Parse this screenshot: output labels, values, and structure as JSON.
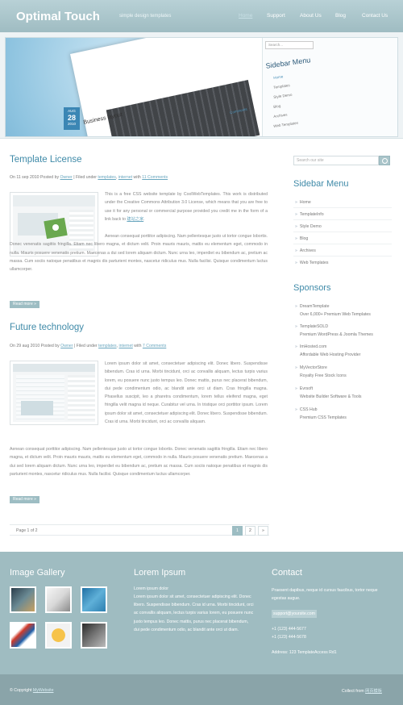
{
  "header": {
    "logo": "Optimal Touch",
    "tagline": "simple design templates",
    "nav": [
      "Home",
      "Support",
      "About Us",
      "Blog",
      "Contact Us"
    ]
  },
  "banner": {
    "search_placeholder": "Search...",
    "menu_title": "Sidebar Menu",
    "menu_items": [
      "Home",
      "Templates",
      "Style Demo",
      "Blog",
      "Archives",
      "Web Templates"
    ],
    "post_title": "Business layout",
    "date_month": "AUG",
    "date_day": "28",
    "date_year": "2010",
    "comments_link": "Comments"
  },
  "posts": [
    {
      "title": "Template License",
      "meta_prefix": "On 11 sep 2010 Posted by ",
      "author": "Owner",
      "meta_mid": " | Filed under ",
      "cat1": "templates",
      "sep": ", ",
      "cat2": "internet",
      "with": " with ",
      "comments": "11 Comments",
      "p1": "This is a free CSS website template by CoolWebTemplates. This work is distributed under the Creative Commons Attribution 3.0 License, which means that you are free to use it for any personal or commercial purpose provided you credit me in the form of a link back to",
      "p1_link": "建站之家",
      "p1_end": ".",
      "p2": "Aenean consequat porttitor adipiscing. Nam pellentesque justo ut tortor congue lobortis. Donec venenatis sagittis fringilla. Etiam nec libero magna, et dictum velit. Proin mauris mauris, mattis eu elementum eget, commodo in nulla. Mauris posuere venenatis pretium. Maecenas a dui sed lorem aliquam dictum. Nunc urna leo, imperdiet eu bibendum ac, pretium ac massa. Cum sociis natoque penatibus et magnis dis parturient montes, nascetur ridiculus mus. Nulla facilisi. Quisque condimentum luctus ullamcorper.",
      "more": "Read more »"
    },
    {
      "title": "Future technology",
      "meta_prefix": "On 29 aug 2010 Posted by ",
      "author": "Owner",
      "meta_mid": " | Filed under ",
      "cat1": "templates",
      "sep": ", ",
      "cat2": "internet",
      "with": " with ",
      "comments": "7 Comments",
      "p1": "Lorem ipsum dolor sit amet, consectetuer adipiscing elit. Donec libero. Suspendisse bibendum. Cras id urna. Morbi tincidunt, orci ac convallis aliquam, lectus turpis varius lorem, eu posuere nunc justo tempus leo. Donec mattis, purus nec placerat bibendum, dui pede condimentum odio, ac blandit ante orci ut diam. Cras fringilla magna. Phasellus suscipit, leo a pharetra condimentum, lorem tellus eleifend magna, eget fringilla velit magna id neque. Curabitur vel urna. In tristique orci porttitor ipsum. Lorem ipsum dolor sit amet, consectetuer adipiscing elit. Donec libero. Suspendisse bibendum. Cras id urna. Morbi tincidunt, orci ac convallis aliquam.",
      "p2": "Aenean consequat porttitor adipiscing. Nam pellentesque justo ut tortor congue lobortis. Donec venenatis sagittis fringilla. Etiam nec libero magna, et dictum velit. Proin mauris mauris, mattis eu elementum eget, commodo in nulla. Mauris posuere venenatis pretium. Maecenas a dui sed lorem aliquam dictum. Nunc urna leo, imperdiet eu bibendum ac, pretium ac massa. Cum sociis natoque penatibus et magnis dis parturient montes, nascetur ridiculus mus. Nulla facilisi. Quisque condimentum luctus ullamcorper.",
      "more": "Read more »"
    }
  ],
  "pager": {
    "label": "Page 1 of 2",
    "pages": [
      "1",
      "2",
      "»"
    ]
  },
  "sidebar": {
    "search_placeholder": "Search our site",
    "menu_title": "Sidebar Menu",
    "menu": [
      "Home",
      "TemplateInfo",
      "Style Demo",
      "Blog",
      "Archives",
      "Web Templates"
    ],
    "sponsors_title": "Sponsors",
    "sponsors": [
      {
        "name": "DreamTemplate",
        "desc": "Over 6,000+ Premium Web Templates"
      },
      {
        "name": "TemplateSOLD",
        "desc": "Premium WordPress & Joomla Themes"
      },
      {
        "name": "ImHosted.com",
        "desc": "Affordable Web Hosting Provider"
      },
      {
        "name": "MyVectorStore",
        "desc": "Royalty Free Stock Icons"
      },
      {
        "name": "Evrsoft",
        "desc": "Website Builder Software & Tools"
      },
      {
        "name": "CSS Hub",
        "desc": "Premium CSS Templates"
      }
    ]
  },
  "footer": {
    "gallery_title": "Image Gallery",
    "lorem_title": "Lorem Ipsum",
    "lorem_heading": "Lorem ipsum dolor",
    "lorem_text": "Lorem ipsum dolor sit amet, consectetuer adipiscing elit. Donec libero. Suspendisse bibendum. Cras id urna. Morbi tincidunt, orci ac convallis aliquam, lectus turpis varius lorem, eu posuere nunc justo tempus leo. Donec mattis, purus nec placerat bibendum, dui pede condimentum odio, ac blandit ante orci ut diam.",
    "contact_title": "Contact",
    "contact_text": "Praesent dapibus, neque id cursus faucibus, tortor neque egestas augue.",
    "email": "support@yoursite.com",
    "phone1": "+1 (123) 444-5677",
    "phone2": "+1 (123) 444-5678",
    "address": "Address: 123 TemplateAccess Rd1",
    "copyright_prefix": "© Copyright ",
    "copyright_link": "MyWebsite",
    "credits_prefix": "Collect from ",
    "credits_link": "网页模板"
  },
  "colors": {
    "accent": "#3f8aa8",
    "header_bg": "#a9c4c9",
    "footer_bg": "#9fbcc1",
    "bottom_bar": "#8aa4a9"
  }
}
